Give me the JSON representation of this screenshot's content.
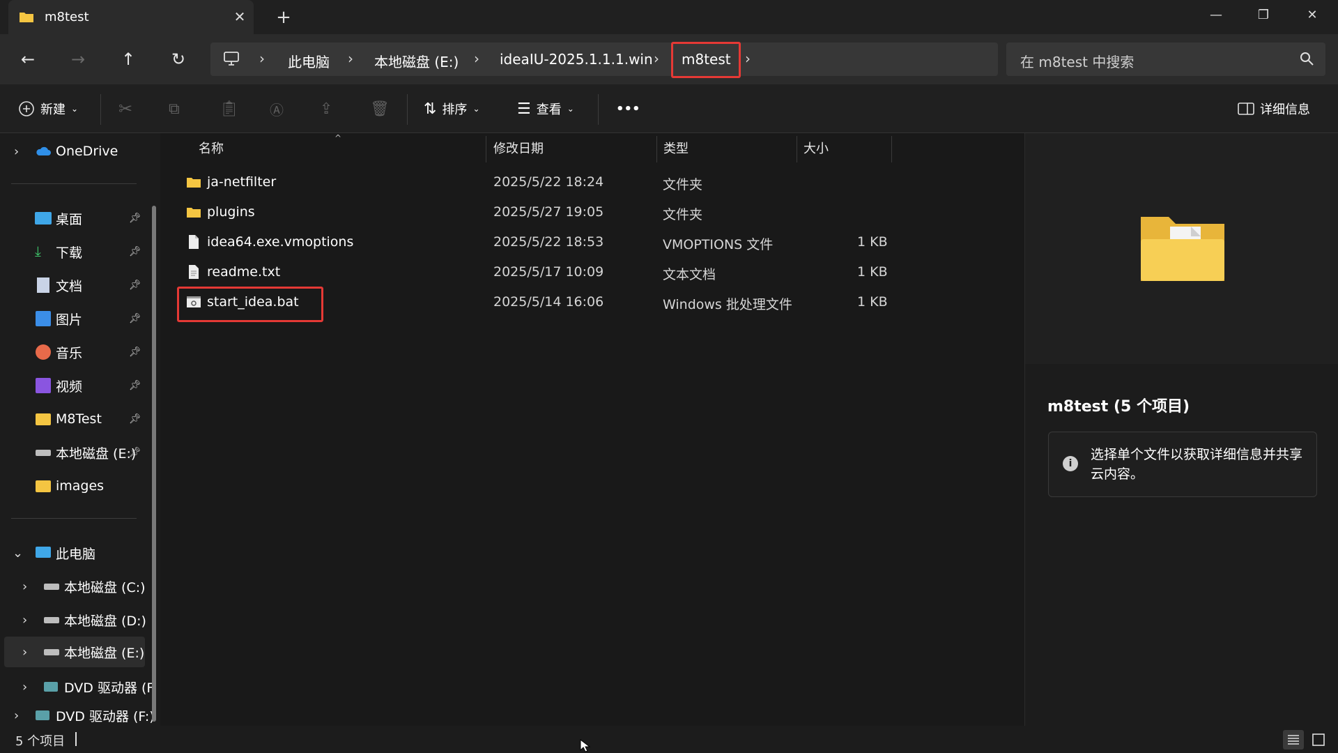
{
  "tab": {
    "title": "m8test",
    "close": "✕",
    "new_tab": "+"
  },
  "window_controls": {
    "minimize": "—",
    "restore": "❐",
    "close": "✕"
  },
  "nav": {
    "back": "←",
    "forward": "→",
    "up": "↑",
    "refresh": "↻"
  },
  "breadcrumb": [
    {
      "label": "此电脑"
    },
    {
      "label": "本地磁盘 (E:)"
    },
    {
      "label": "ideaIU-2025.1.1.1.win"
    },
    {
      "label": "m8test"
    }
  ],
  "search": {
    "placeholder": "在 m8test 中搜索"
  },
  "toolbar": {
    "new_label": "新建",
    "sort_label": "排序",
    "view_label": "查看",
    "more_label": "•••",
    "details_label": "详细信息"
  },
  "sidebar": {
    "onedrive": "OneDrive",
    "quick": [
      {
        "label": "桌面",
        "icon": "desktop-icon"
      },
      {
        "label": "下载",
        "icon": "download-icon"
      },
      {
        "label": "文档",
        "icon": "document-icon"
      },
      {
        "label": "图片",
        "icon": "pictures-icon"
      },
      {
        "label": "音乐",
        "icon": "music-icon"
      },
      {
        "label": "视频",
        "icon": "video-icon"
      },
      {
        "label": "M8Test",
        "icon": "folder-icon"
      },
      {
        "label": "本地磁盘 (E:)",
        "icon": "drive-icon"
      },
      {
        "label": "images",
        "icon": "folder-icon"
      }
    ],
    "this_pc": "此电脑",
    "drives": [
      {
        "label": "本地磁盘 (C:)"
      },
      {
        "label": "本地磁盘 (D:)"
      },
      {
        "label": "本地磁盘 (E:)"
      },
      {
        "label": "DVD 驱动器 (F"
      }
    ],
    "dvd": "DVD 驱动器 (F:)"
  },
  "columns": {
    "name": "名称",
    "modified": "修改日期",
    "type": "类型",
    "size": "大小"
  },
  "files": [
    {
      "name": "ja-netfilter",
      "modified": "2025/5/22 18:24",
      "type": "文件夹",
      "size": "",
      "icon": "folder-icon"
    },
    {
      "name": "plugins",
      "modified": "2025/5/27 19:05",
      "type": "文件夹",
      "size": "",
      "icon": "folder-icon"
    },
    {
      "name": "idea64.exe.vmoptions",
      "modified": "2025/5/22 18:53",
      "type": "VMOPTIONS 文件",
      "size": "1 KB",
      "icon": "file-icon"
    },
    {
      "name": "readme.txt",
      "modified": "2025/5/17 10:09",
      "type": "文本文档",
      "size": "1 KB",
      "icon": "text-file-icon"
    },
    {
      "name": "start_idea.bat",
      "modified": "2025/5/14 16:06",
      "type": "Windows 批处理文件",
      "size": "1 KB",
      "icon": "batch-file-icon"
    }
  ],
  "details": {
    "title": "m8test (5 个项目)",
    "info": "选择单个文件以获取详细信息并共享云内容。"
  },
  "status": {
    "count": "5 个项目"
  },
  "colors": {
    "highlight_box": "#e53935",
    "folder": "#f4c542",
    "onedrive": "#2f8fe8"
  }
}
